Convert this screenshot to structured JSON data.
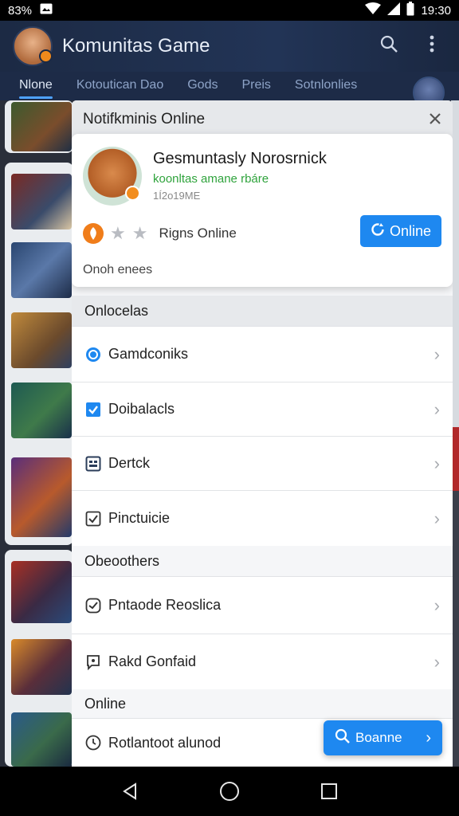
{
  "status_bar": {
    "left_text": "83%",
    "time": "19:30",
    "icons": [
      "battery-icon",
      "photo-icon",
      "wifi-icon",
      "signal-icon",
      "battery-status-icon"
    ]
  },
  "app_bar": {
    "title": "Komunitas Game",
    "icons": [
      "search-icon",
      "more-vert-icon"
    ]
  },
  "tabs": [
    {
      "label": "Nlone",
      "active": true
    },
    {
      "label": "Kotoutican Dao",
      "active": false
    },
    {
      "label": "Gods",
      "active": false
    },
    {
      "label": "Preis",
      "active": false
    },
    {
      "label": "Sotnlonlies",
      "active": false
    }
  ],
  "sheet": {
    "header_title": "Notifkminis Online",
    "profile": {
      "name": "Gesmuntasly Norosrnick",
      "subtitle": "koonltas amane rbáre",
      "meta": "1Í2o19ME",
      "rank_label": "Rigns Online",
      "online_button": "Online",
      "footer": "Onoh enees"
    },
    "section_1": {
      "title": "Onlocelas",
      "rows": [
        {
          "label": "Gamdconiks",
          "icon": "gamepad-icon"
        },
        {
          "label": "Doibalacls",
          "icon": "checkbox-icon"
        },
        {
          "label": "Dertck",
          "icon": "grid-icon"
        },
        {
          "label": "Pinctuicie",
          "icon": "check-square-icon"
        }
      ]
    },
    "section_2": {
      "title": "Obeoothers",
      "rows": [
        {
          "label": "Pntaode Reoslica",
          "icon": "badge-check-icon"
        },
        {
          "label": "Rakd Gonfaid",
          "icon": "chat-icon"
        }
      ]
    },
    "section_3": {
      "title": "Online",
      "rows": [
        {
          "label": "Rotlantoot alunod",
          "icon": "clock-icon"
        }
      ]
    },
    "fab": {
      "label": "Boanne",
      "icon": "search-icon"
    }
  },
  "colors": {
    "accent": "#1e88f0",
    "online_green": "#2fa33c",
    "rank_orange": "#f07d1a",
    "header_bg": "#1c2a44"
  }
}
